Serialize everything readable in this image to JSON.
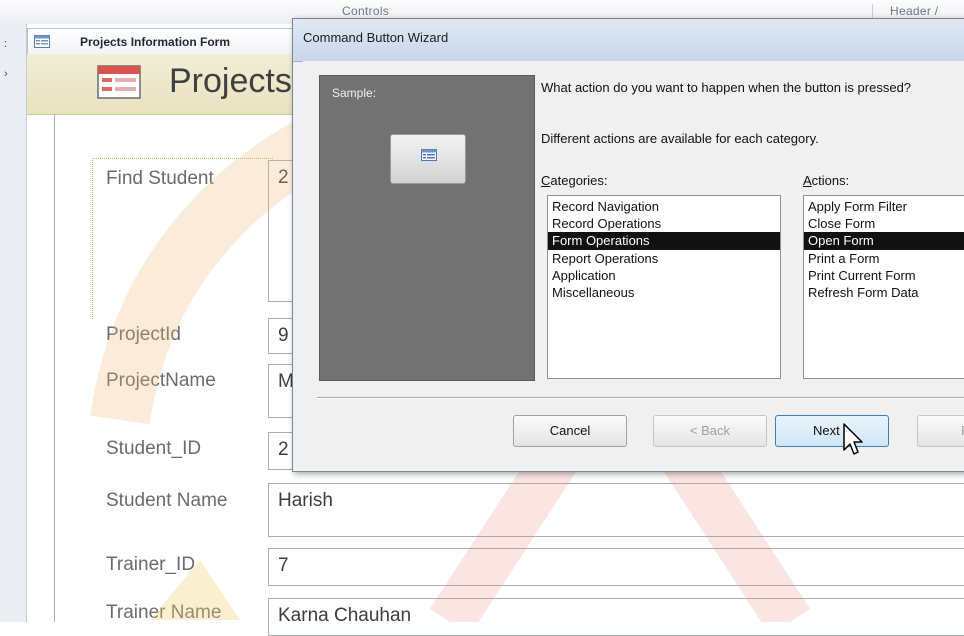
{
  "ribbon": {
    "controls_label": "Controls",
    "header_label": "Header /"
  },
  "document_tab": {
    "label": "Projects Information Form"
  },
  "form": {
    "title": "Projects",
    "fields": [
      {
        "label": "Find Student",
        "value": "2"
      },
      {
        "label": "ProjectId",
        "value": "9"
      },
      {
        "label": "ProjectName",
        "value": "M"
      },
      {
        "label": "Student_ID",
        "value": "2"
      },
      {
        "label": "Student Name",
        "value": "Harish"
      },
      {
        "label": "Trainer_ID",
        "value": "7"
      },
      {
        "label": "Trainer Name",
        "value": "Karna Chauhan"
      }
    ]
  },
  "wizard": {
    "title": "Command Button Wizard",
    "sample_label": "Sample:",
    "question": "What action do you want to happen when the button is pressed?",
    "hint": "Different actions are available for each category.",
    "categories_label": "Categories:",
    "actions_label": "Actions:",
    "categories": [
      "Record Navigation",
      "Record Operations",
      "Form Operations",
      "Report Operations",
      "Application",
      "Miscellaneous"
    ],
    "selected_category": "Form Operations",
    "actions": [
      "Apply Form Filter",
      "Close Form",
      "Open Form",
      "Print a Form",
      "Print Current Form",
      "Refresh Form Data"
    ],
    "selected_action": "Open Form",
    "buttons": {
      "cancel": "Cancel",
      "back": "< Back",
      "next": "Next >",
      "finish": "Fi"
    }
  },
  "colors": {
    "selection": "#111111",
    "form_header": "#ede7c8",
    "sample_panel": "#727272",
    "dialog_title": "#c9d7ea"
  },
  "icons": [
    "form-icon",
    "mouse-cursor-icon",
    "sample-button-icon"
  ]
}
